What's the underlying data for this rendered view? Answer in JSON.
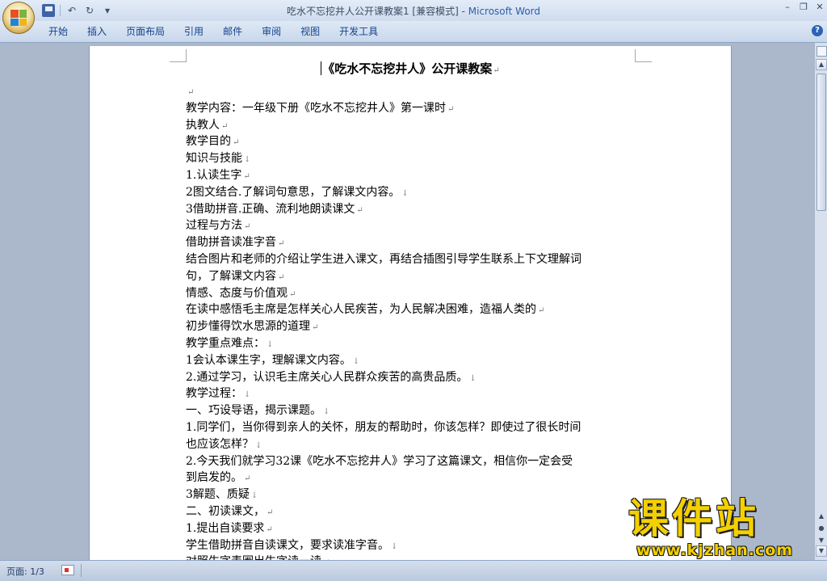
{
  "window": {
    "title_doc": "吃水不忘挖井人公开课教案1 [兼容模式] - ",
    "title_app": "Microsoft Word"
  },
  "qat": {
    "save": "save-icon",
    "undo": "↶",
    "redo": "↻",
    "more": "▾"
  },
  "window_controls": {
    "minimize": "–",
    "restore": "❐",
    "close": "✕"
  },
  "ribbon": {
    "tabs": [
      "开始",
      "插入",
      "页面布局",
      "引用",
      "邮件",
      "审阅",
      "视图",
      "开发工具"
    ],
    "help": "?"
  },
  "document": {
    "title": "《吃水不忘挖井人》公开课教案",
    "lines": [
      {
        "text": "",
        "mark": "↵"
      },
      {
        "text": "教学内容：一年级下册《吃水不忘挖井人》第一课时",
        "mark": "↵"
      },
      {
        "text": "执教人",
        "mark": "↵"
      },
      {
        "text": "教学目的",
        "mark": "↵"
      },
      {
        "text": "知识与技能",
        "mark": "↓"
      },
      {
        "text": "1.认读生字",
        "mark": "↵"
      },
      {
        "text": "2图文结合.了解词句意思，了解课文内容。",
        "mark": "↓"
      },
      {
        "text": "3借助拼音.正确、流利地朗读课文",
        "mark": "↵"
      },
      {
        "text": "过程与方法",
        "mark": "↵"
      },
      {
        "text": "借助拼音读准字音",
        "mark": "↵"
      },
      {
        "text": "结合图片和老师的介绍让学生进入课文，再结合插图引导学生联系上下文理解词",
        "mark": ""
      },
      {
        "text": "句，了解课文内容",
        "mark": "↵"
      },
      {
        "text": "情感、态度与价值观",
        "mark": "↵"
      },
      {
        "text": "在读中感悟毛主席是怎样关心人民疾苦，为人民解决困难，造福人类的",
        "mark": "↵"
      },
      {
        "text": "初步懂得饮水思源的道理",
        "mark": "↵"
      },
      {
        "text": "教学重点难点：",
        "mark": "↓"
      },
      {
        "text": "1会认本课生字，理解课文内容。",
        "mark": "↓"
      },
      {
        "text": "2.通过学习，认识毛主席关心人民群众疾苦的高贵品质。",
        "mark": "↓"
      },
      {
        "text": "教学过程：",
        "mark": "↓"
      },
      {
        "text": "一、巧设导语，揭示课题。",
        "mark": "↓"
      },
      {
        "text": "1.同学们，当你得到亲人的关怀，朋友的帮助时，你该怎样？即使过了很长时间",
        "mark": ""
      },
      {
        "text": "也应该怎样？",
        "mark": "↓"
      },
      {
        "text": "2.今天我们就学习32课《吃水不忘挖井人》学习了这篇课文，相信你一定会受",
        "mark": ""
      },
      {
        "text": "到启发的。",
        "mark": "↵"
      },
      {
        "text": "3解题、质疑",
        "mark": "↓"
      },
      {
        "text": "二、初读课文，",
        "mark": "↵"
      },
      {
        "text": "1.提出自读要求",
        "mark": "↵"
      },
      {
        "text": "学生借助拼音自读课文，要求读准字音。",
        "mark": "↓"
      },
      {
        "text": "对照生字表圈出生字读一读",
        "mark": "↵"
      }
    ]
  },
  "status": {
    "page": "页面: 1/3"
  },
  "watermark": {
    "big": "课件站",
    "url": "www.kjzhan.com"
  }
}
